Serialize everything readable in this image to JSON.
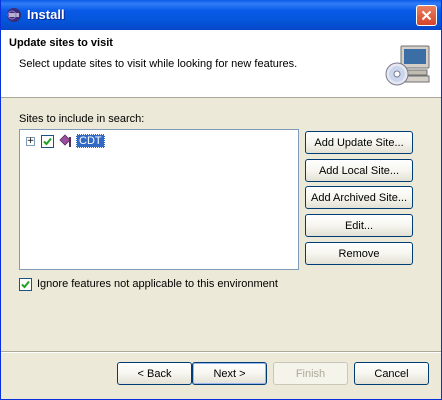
{
  "window": {
    "title": "Install",
    "title_icon": "eclipse-icon",
    "close_icon": "close-icon"
  },
  "header": {
    "title": "Update sites to visit",
    "description": "Select update sites to visit while looking for new features.",
    "art_icon": "computer-cd-icon"
  },
  "sites": {
    "label": "Sites to include in search:",
    "items": [
      {
        "label": "CDT",
        "checked": true,
        "expanded": false,
        "icon": "site-diamond-icon"
      }
    ]
  },
  "side_buttons": {
    "add_update_site": "Add Update Site...",
    "add_local_site": "Add Local Site...",
    "add_archived_site": "Add Archived Site...",
    "edit": "Edit...",
    "remove": "Remove"
  },
  "options": {
    "ignore_label": "Ignore features not applicable to this environment",
    "ignore_checked": true
  },
  "footer": {
    "back": "< Back",
    "next": "Next >",
    "finish": "Finish",
    "cancel": "Cancel",
    "finish_enabled": false
  },
  "colors": {
    "titlebar": "#0a5ae9",
    "selection": "#316ac5",
    "dialog_bg": "#ece9d8"
  }
}
